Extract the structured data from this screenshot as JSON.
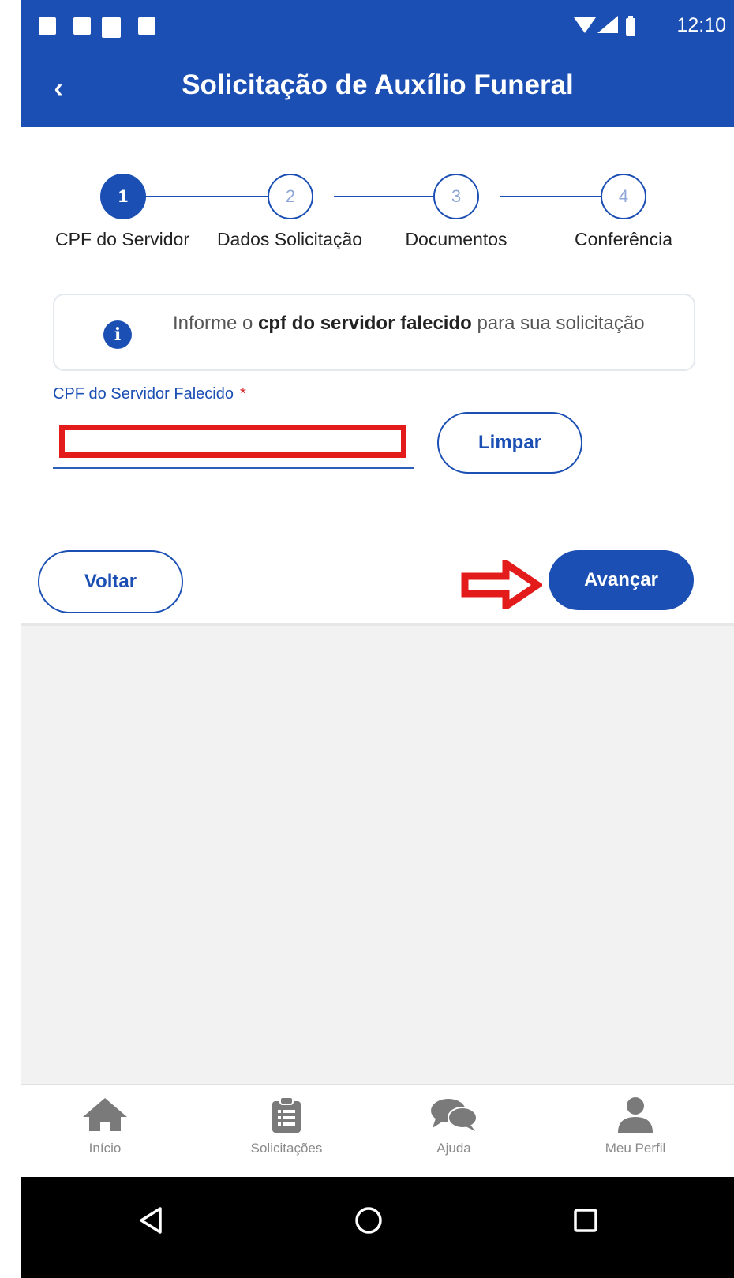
{
  "status_bar": {
    "time": "12:10"
  },
  "header": {
    "title": "Solicitação de Auxílio Funeral",
    "back_icon": "chevron-left-icon"
  },
  "stepper": {
    "steps": [
      {
        "number": "1",
        "label": "CPF do Servidor",
        "active": true
      },
      {
        "number": "2",
        "label": "Dados Solicitação",
        "active": false
      },
      {
        "number": "3",
        "label": "Documentos",
        "active": false
      },
      {
        "number": "4",
        "label": "Conferência",
        "active": false
      }
    ]
  },
  "info": {
    "icon": "info-icon",
    "text_prefix": "Informe o ",
    "text_bold": "cpf do servidor falecido",
    "text_suffix": " para sua solicitação"
  },
  "form": {
    "cpf_label": "CPF do Servidor Falecido",
    "required_mark": "*",
    "cpf_value": "",
    "clear_label": "Limpar"
  },
  "actions": {
    "back_label": "Voltar",
    "next_label": "Avançar"
  },
  "bottom_nav": {
    "items": [
      {
        "label": "Início",
        "icon": "home-icon"
      },
      {
        "label": "Solicitações",
        "icon": "clipboard-icon"
      },
      {
        "label": "Ajuda",
        "icon": "chat-icon"
      },
      {
        "label": "Meu Perfil",
        "icon": "user-icon"
      }
    ]
  },
  "colors": {
    "primary": "#1b4fb4",
    "annotation_red": "#e31b1b"
  }
}
